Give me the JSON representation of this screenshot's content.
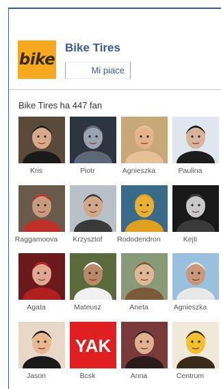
{
  "page": {
    "name": "Bike Tires",
    "logo_text": "bike"
  },
  "like_button": {
    "label": "Mi piace"
  },
  "fans_header": "Bike Tires ha 447 fan",
  "fans": [
    {
      "name": "Kris",
      "bg": "#5a4a3a",
      "fg": "#1a1a1a",
      "skin": "#d7a98a"
    },
    {
      "name": "Piotr",
      "bg": "#2c3440",
      "fg": "#5c6878",
      "skin": "#9aa4b0"
    },
    {
      "name": "Agnieszka",
      "bg": "#c8a878",
      "fg": "#e8c098",
      "skin": "#e4b38e"
    },
    {
      "name": "Paulina",
      "bg": "#dfe6ee",
      "fg": "#1c1c1c",
      "skin": "#d8b29a"
    },
    {
      "name": "Raggamoova",
      "bg": "#6a5a4a",
      "fg": "#c0302a",
      "skin": "#c89a80"
    },
    {
      "name": "Krzysztof",
      "bg": "#b8c0c8",
      "fg": "#3a3a3a",
      "skin": "#d0a888"
    },
    {
      "name": "Rododendron",
      "bg": "#3a6a8a",
      "fg": "#e0a020",
      "skin": "#e8b030"
    },
    {
      "name": "Kejti",
      "bg": "#181818",
      "fg": "#3a3a3a",
      "skin": "#c8c8c8"
    },
    {
      "name": "Agata",
      "bg": "#6a1a1a",
      "fg": "#b02020",
      "skin": "#e0a890"
    },
    {
      "name": "Mateusz",
      "bg": "#5a6a3a",
      "fg": "#f0f0f0",
      "skin": "#b88868"
    },
    {
      "name": "Aneta",
      "bg": "#889a78",
      "fg": "#7a5a3a",
      "skin": "#e0b898"
    },
    {
      "name": "Agnieszka",
      "bg": "#9ac0e0",
      "fg": "#e8e8e8",
      "skin": "#c89878"
    },
    {
      "name": "Jason",
      "bg": "#e8d8c8",
      "fg": "#1a1a1a",
      "skin": "#e8b890"
    },
    {
      "name": "Bcsk",
      "bg": "#e02020",
      "fg": "#ffffff",
      "skin": "#e02020",
      "text": "YAK"
    },
    {
      "name": "Anna",
      "bg": "#7a3a3a",
      "fg": "#2a1a1a",
      "skin": "#e0b090"
    },
    {
      "name": "Centrum",
      "bg": "#f0e8d8",
      "fg": "#3a2a1a",
      "skin": "#f0c030"
    }
  ]
}
